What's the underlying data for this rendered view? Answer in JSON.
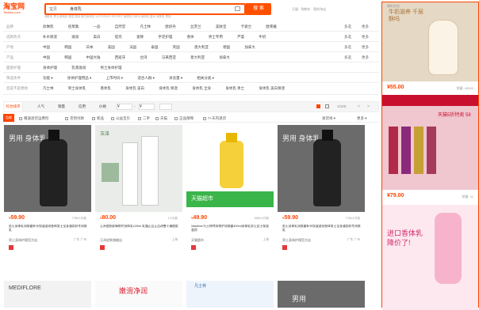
{
  "header": {
    "logo_text": "淘宝网",
    "logo_domain": "Taobao.com",
    "search_category": "宝贝",
    "search_value": "身体乳",
    "search_button": "搜 索",
    "hot_words": "润肤乳 男士身体乳 保湿 滋润 美白身体乳 VICTORIA'S SECRET 身体乳 SHEA 身体乳 香水 润体乳 男用",
    "top_links": [
      "天猫",
      "购物车",
      "我的淘宝"
    ]
  },
  "filters": [
    {
      "label": "品牌",
      "options": [
        "玫琳凯",
        "佰草集",
        "一品",
        "自然堂",
        "凡士林",
        "欧舒丹",
        "丝芙兰",
        "美肤宝",
        "卡姿兰",
        "欧莱雅"
      ],
      "multi": "多选",
      "more": "更多"
    },
    {
      "label": "选购热点",
      "options": [
        "补水保湿",
        "滋润",
        "美白",
        "提亮",
        "紧致",
        "手足护理",
        "香体",
        "男士专用",
        "芦荟",
        "牛奶"
      ],
      "multi": "多选",
      "more": "更多"
    },
    {
      "label": "产地",
      "options": [
        "中国",
        "韩国",
        "日本",
        "美国",
        "法国",
        "泰国",
        "英国",
        "澳大利亚",
        "德国",
        "加拿大"
      ],
      "multi": "多选",
      "more": "更多"
    },
    {
      "label": "产品",
      "options": [
        "中国",
        "韩国",
        "中国大陆",
        "西班牙",
        "台湾",
        "马来西亚",
        "意大利亚",
        "加拿大"
      ],
      "multi": "多选",
      "more": "更多"
    },
    {
      "label": "面部护理",
      "options": [
        "身体护理",
        "乳液滋润",
        "男士身体护理"
      ],
      "multi": "",
      "more": ""
    },
    {
      "label": "筛选条件",
      "options": [
        "功能 ▾",
        "身体护理用品 ▾",
        "上市时间 ▾",
        "适合人群 ▾",
        "净含量 ▾",
        "相关分类 ▾"
      ],
      "multi": "",
      "more": ""
    },
    {
      "label": "您是不是想找",
      "options": [
        "凡士林",
        "男士身体乳",
        "香体乳",
        "身体乳 美白",
        "身体乳 保湿",
        "身体乳 全身",
        "身体乳 男士",
        "身体乳 美白保湿"
      ],
      "multi": "",
      "more": ""
    }
  ],
  "sortbar": {
    "items": [
      "综合排序",
      "人气",
      "销量",
      "信用",
      "价格"
    ],
    "price_from": "¥",
    "price_to": "¥",
    "page": "1/100"
  },
  "checkbar": {
    "delivery": "包邮",
    "checks": [
      "赠送退货运费险",
      "货到付款",
      "新品",
      "公益宝贝",
      "二手",
      "天猫",
      "正品保障",
      "7+天内退货"
    ],
    "right": [
      "发货地 ▾",
      "更多 ▾"
    ]
  },
  "products": [
    {
      "price": "59.90",
      "sales": "7786人付款",
      "title": "男士身体乳润肤露补水保湿滋润香体男士全身通用秋冬润肤乳",
      "shop": "男士身体护理官方店",
      "loc": "广东 广州",
      "tag": "男用 身体乳"
    },
    {
      "price": "80.00",
      "sales": "1人付款",
      "title": "玉泽皮肤屏障修护身体乳120ml 乳霜正品正品改善干燥脱皮",
      "shop": "玉泽皮肤旗舰店",
      "loc": "上海",
      "tag": "玉泽"
    },
    {
      "price": "49.90",
      "sales": "6565人付款",
      "title": "Vaseline/凡士林特润修护润肤露400ml身体乳男士女士保湿滋润",
      "shop": "天猫超市",
      "loc": "上海",
      "tag": "天猫超市"
    },
    {
      "price": "59.90",
      "sales": "7786人付款",
      "title": "男士身体乳润肤露补水保湿滋润香体男士全身通用秋冬润肤乳",
      "shop": "男士身体护理官方店",
      "loc": "广东 广州",
      "tag": "男用 身体乳"
    }
  ],
  "row2": [
    {
      "tag": "MEDIFLORE"
    },
    {
      "tag": "嫩滑净润"
    },
    {
      "tag": "凡士林"
    },
    {
      "tag": "男用"
    }
  ],
  "ads": {
    "label": "掌柜热卖",
    "items": [
      {
        "price": "55.00",
        "sales": "销量: 45262",
        "tag": "牛奶滋养 千层酥吗"
      },
      {
        "price": "79.00",
        "sales": "销量: 11",
        "tag": "天猫5折特卖 58"
      },
      {
        "price": "79.00",
        "sales": "销量: 67",
        "tag": "进口香体乳 降价了!"
      }
    ]
  },
  "colors": {
    "accent": "#ff4400",
    "brand": "#ff5000"
  }
}
